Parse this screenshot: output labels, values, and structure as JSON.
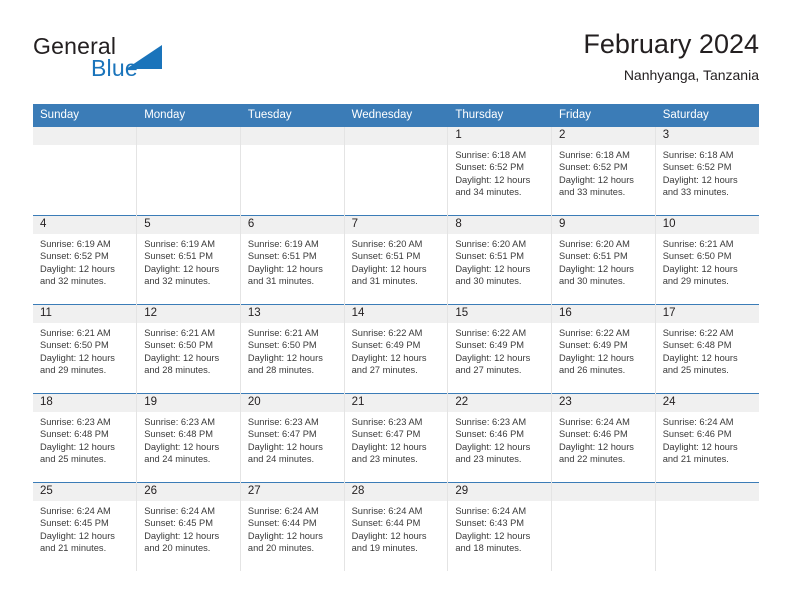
{
  "brand": {
    "name_part1": "General",
    "name_part2": "Blue",
    "accent_color": "#1a74bb",
    "logo_icon": "triangle-flag-icon"
  },
  "header": {
    "title": "February 2024",
    "subtitle": "Nanhyanga, Tanzania",
    "header_bg_color": "#3b7cb7",
    "daynum_bg_color": "#f0f0f0"
  },
  "weekdays": [
    "Sunday",
    "Monday",
    "Tuesday",
    "Wednesday",
    "Thursday",
    "Friday",
    "Saturday"
  ],
  "labels": {
    "sunrise": "Sunrise:",
    "sunset": "Sunset:",
    "daylight": "Daylight:"
  },
  "weeks": [
    [
      {
        "day": "",
        "sunrise": "",
        "sunset": "",
        "daylight_l1": "",
        "daylight_l2": ""
      },
      {
        "day": "",
        "sunrise": "",
        "sunset": "",
        "daylight_l1": "",
        "daylight_l2": ""
      },
      {
        "day": "",
        "sunrise": "",
        "sunset": "",
        "daylight_l1": "",
        "daylight_l2": ""
      },
      {
        "day": "",
        "sunrise": "",
        "sunset": "",
        "daylight_l1": "",
        "daylight_l2": ""
      },
      {
        "day": "1",
        "sunrise": "Sunrise: 6:18 AM",
        "sunset": "Sunset: 6:52 PM",
        "daylight_l1": "Daylight: 12 hours",
        "daylight_l2": "and 34 minutes."
      },
      {
        "day": "2",
        "sunrise": "Sunrise: 6:18 AM",
        "sunset": "Sunset: 6:52 PM",
        "daylight_l1": "Daylight: 12 hours",
        "daylight_l2": "and 33 minutes."
      },
      {
        "day": "3",
        "sunrise": "Sunrise: 6:18 AM",
        "sunset": "Sunset: 6:52 PM",
        "daylight_l1": "Daylight: 12 hours",
        "daylight_l2": "and 33 minutes."
      }
    ],
    [
      {
        "day": "4",
        "sunrise": "Sunrise: 6:19 AM",
        "sunset": "Sunset: 6:52 PM",
        "daylight_l1": "Daylight: 12 hours",
        "daylight_l2": "and 32 minutes."
      },
      {
        "day": "5",
        "sunrise": "Sunrise: 6:19 AM",
        "sunset": "Sunset: 6:51 PM",
        "daylight_l1": "Daylight: 12 hours",
        "daylight_l2": "and 32 minutes."
      },
      {
        "day": "6",
        "sunrise": "Sunrise: 6:19 AM",
        "sunset": "Sunset: 6:51 PM",
        "daylight_l1": "Daylight: 12 hours",
        "daylight_l2": "and 31 minutes."
      },
      {
        "day": "7",
        "sunrise": "Sunrise: 6:20 AM",
        "sunset": "Sunset: 6:51 PM",
        "daylight_l1": "Daylight: 12 hours",
        "daylight_l2": "and 31 minutes."
      },
      {
        "day": "8",
        "sunrise": "Sunrise: 6:20 AM",
        "sunset": "Sunset: 6:51 PM",
        "daylight_l1": "Daylight: 12 hours",
        "daylight_l2": "and 30 minutes."
      },
      {
        "day": "9",
        "sunrise": "Sunrise: 6:20 AM",
        "sunset": "Sunset: 6:51 PM",
        "daylight_l1": "Daylight: 12 hours",
        "daylight_l2": "and 30 minutes."
      },
      {
        "day": "10",
        "sunrise": "Sunrise: 6:21 AM",
        "sunset": "Sunset: 6:50 PM",
        "daylight_l1": "Daylight: 12 hours",
        "daylight_l2": "and 29 minutes."
      }
    ],
    [
      {
        "day": "11",
        "sunrise": "Sunrise: 6:21 AM",
        "sunset": "Sunset: 6:50 PM",
        "daylight_l1": "Daylight: 12 hours",
        "daylight_l2": "and 29 minutes."
      },
      {
        "day": "12",
        "sunrise": "Sunrise: 6:21 AM",
        "sunset": "Sunset: 6:50 PM",
        "daylight_l1": "Daylight: 12 hours",
        "daylight_l2": "and 28 minutes."
      },
      {
        "day": "13",
        "sunrise": "Sunrise: 6:21 AM",
        "sunset": "Sunset: 6:50 PM",
        "daylight_l1": "Daylight: 12 hours",
        "daylight_l2": "and 28 minutes."
      },
      {
        "day": "14",
        "sunrise": "Sunrise: 6:22 AM",
        "sunset": "Sunset: 6:49 PM",
        "daylight_l1": "Daylight: 12 hours",
        "daylight_l2": "and 27 minutes."
      },
      {
        "day": "15",
        "sunrise": "Sunrise: 6:22 AM",
        "sunset": "Sunset: 6:49 PM",
        "daylight_l1": "Daylight: 12 hours",
        "daylight_l2": "and 27 minutes."
      },
      {
        "day": "16",
        "sunrise": "Sunrise: 6:22 AM",
        "sunset": "Sunset: 6:49 PM",
        "daylight_l1": "Daylight: 12 hours",
        "daylight_l2": "and 26 minutes."
      },
      {
        "day": "17",
        "sunrise": "Sunrise: 6:22 AM",
        "sunset": "Sunset: 6:48 PM",
        "daylight_l1": "Daylight: 12 hours",
        "daylight_l2": "and 25 minutes."
      }
    ],
    [
      {
        "day": "18",
        "sunrise": "Sunrise: 6:23 AM",
        "sunset": "Sunset: 6:48 PM",
        "daylight_l1": "Daylight: 12 hours",
        "daylight_l2": "and 25 minutes."
      },
      {
        "day": "19",
        "sunrise": "Sunrise: 6:23 AM",
        "sunset": "Sunset: 6:48 PM",
        "daylight_l1": "Daylight: 12 hours",
        "daylight_l2": "and 24 minutes."
      },
      {
        "day": "20",
        "sunrise": "Sunrise: 6:23 AM",
        "sunset": "Sunset: 6:47 PM",
        "daylight_l1": "Daylight: 12 hours",
        "daylight_l2": "and 24 minutes."
      },
      {
        "day": "21",
        "sunrise": "Sunrise: 6:23 AM",
        "sunset": "Sunset: 6:47 PM",
        "daylight_l1": "Daylight: 12 hours",
        "daylight_l2": "and 23 minutes."
      },
      {
        "day": "22",
        "sunrise": "Sunrise: 6:23 AM",
        "sunset": "Sunset: 6:46 PM",
        "daylight_l1": "Daylight: 12 hours",
        "daylight_l2": "and 23 minutes."
      },
      {
        "day": "23",
        "sunrise": "Sunrise: 6:24 AM",
        "sunset": "Sunset: 6:46 PM",
        "daylight_l1": "Daylight: 12 hours",
        "daylight_l2": "and 22 minutes."
      },
      {
        "day": "24",
        "sunrise": "Sunrise: 6:24 AM",
        "sunset": "Sunset: 6:46 PM",
        "daylight_l1": "Daylight: 12 hours",
        "daylight_l2": "and 21 minutes."
      }
    ],
    [
      {
        "day": "25",
        "sunrise": "Sunrise: 6:24 AM",
        "sunset": "Sunset: 6:45 PM",
        "daylight_l1": "Daylight: 12 hours",
        "daylight_l2": "and 21 minutes."
      },
      {
        "day": "26",
        "sunrise": "Sunrise: 6:24 AM",
        "sunset": "Sunset: 6:45 PM",
        "daylight_l1": "Daylight: 12 hours",
        "daylight_l2": "and 20 minutes."
      },
      {
        "day": "27",
        "sunrise": "Sunrise: 6:24 AM",
        "sunset": "Sunset: 6:44 PM",
        "daylight_l1": "Daylight: 12 hours",
        "daylight_l2": "and 20 minutes."
      },
      {
        "day": "28",
        "sunrise": "Sunrise: 6:24 AM",
        "sunset": "Sunset: 6:44 PM",
        "daylight_l1": "Daylight: 12 hours",
        "daylight_l2": "and 19 minutes."
      },
      {
        "day": "29",
        "sunrise": "Sunrise: 6:24 AM",
        "sunset": "Sunset: 6:43 PM",
        "daylight_l1": "Daylight: 12 hours",
        "daylight_l2": "and 18 minutes."
      },
      {
        "day": "",
        "sunrise": "",
        "sunset": "",
        "daylight_l1": "",
        "daylight_l2": ""
      },
      {
        "day": "",
        "sunrise": "",
        "sunset": "",
        "daylight_l1": "",
        "daylight_l2": ""
      }
    ]
  ]
}
